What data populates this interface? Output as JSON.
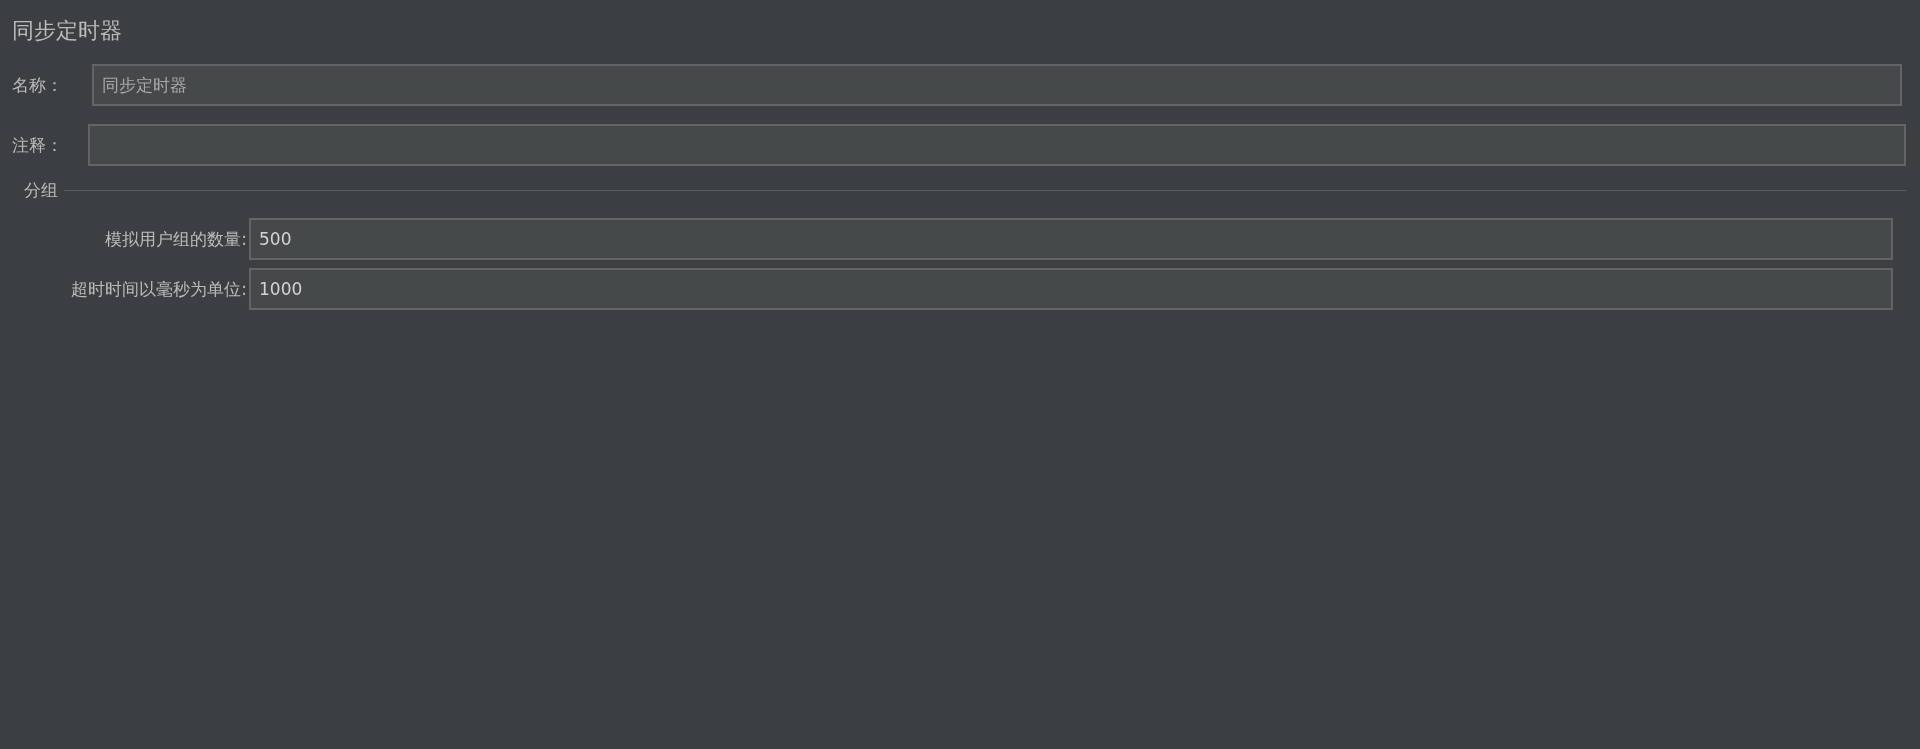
{
  "title": "同步定时器",
  "fields": [
    {
      "label": "名称：",
      "value": "同步定时器"
    },
    {
      "label": "注释："
    }
  ],
  "group": {
    "title": "分组",
    "fields": [
      {
        "label": "模拟用户组的数量:",
        "value": "500"
      },
      {
        "label": "超时时间以毫秒为单位:",
        "value": "1000"
      }
    ]
  }
}
